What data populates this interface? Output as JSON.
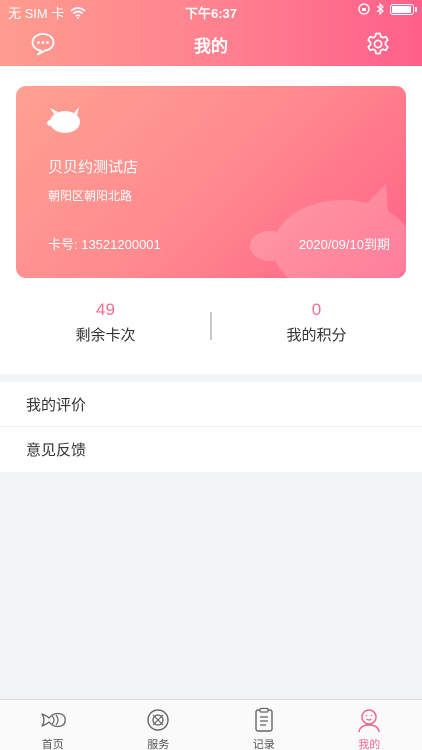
{
  "status_bar": {
    "carrier": "无 SIM 卡",
    "time": "下午6:37"
  },
  "header": {
    "title": "我的",
    "left_icon": "chat-bubble-icon",
    "right_icon": "gear-icon"
  },
  "card": {
    "store_name": "贝贝约测试店",
    "address": "朝阳区朝阳北路",
    "card_number": "卡号: 13521200001",
    "expiry": "2020/09/10到期",
    "logo_icon": "piggy-logo-icon"
  },
  "stats": {
    "remaining": {
      "value": "49",
      "label": "剩余卡次"
    },
    "points": {
      "value": "0",
      "label": "我的积分"
    }
  },
  "menu": {
    "items": [
      {
        "label": "我的评价"
      },
      {
        "label": "意见反馈"
      }
    ]
  },
  "tabbar": {
    "tabs": [
      {
        "label": "首页",
        "icon": "fish-icon"
      },
      {
        "label": "服务",
        "icon": "service-icon"
      },
      {
        "label": "记录",
        "icon": "clipboard-icon"
      },
      {
        "label": "我的",
        "icon": "person-icon"
      }
    ],
    "active_index": 3,
    "active_color": "#f0678a"
  },
  "colors": {
    "accent": "#f06e8e",
    "header_start": "#ff9c8f",
    "header_end": "#ff5f8a"
  }
}
